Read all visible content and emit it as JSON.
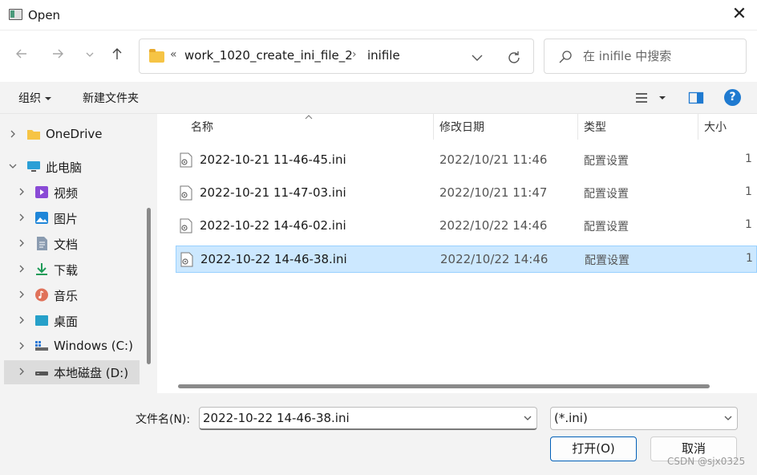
{
  "window": {
    "title": "Open",
    "close_glyph": "✕"
  },
  "nav": {
    "back_icon": "arrow-left-icon",
    "forward_icon": "arrow-right-icon",
    "recent_icon": "chevron-down-icon",
    "up_icon": "arrow-up-icon",
    "breadcrumb_overflow": "«",
    "breadcrumb": [
      "work_1020_create_ini_file_2",
      "inifile"
    ],
    "breadcrumb_sep": "›",
    "search_placeholder": "在 inifile 中搜索"
  },
  "toolbar": {
    "organize_label": "组织",
    "new_folder_label": "新建文件夹",
    "help_label": "?"
  },
  "sidebar": {
    "items": [
      {
        "label": "OneDrive",
        "icon": "folder-icon",
        "expanded": false
      },
      {
        "label": "此电脑",
        "icon": "computer-icon",
        "expanded": true
      },
      {
        "label": "视频",
        "icon": "videos-icon",
        "expanded": false
      },
      {
        "label": "图片",
        "icon": "pictures-icon",
        "expanded": false
      },
      {
        "label": "文档",
        "icon": "documents-icon",
        "expanded": false
      },
      {
        "label": "下载",
        "icon": "downloads-icon",
        "expanded": false
      },
      {
        "label": "音乐",
        "icon": "music-icon",
        "expanded": false
      },
      {
        "label": "桌面",
        "icon": "desktop-icon",
        "expanded": false
      },
      {
        "label": "Windows (C:)",
        "icon": "drive-icon",
        "expanded": false
      },
      {
        "label": "本地磁盘 (D:)",
        "icon": "drive-icon",
        "expanded": false,
        "selected": true
      }
    ]
  },
  "columns": {
    "name": "名称",
    "date": "修改日期",
    "type": "类型",
    "size": "大小"
  },
  "files": [
    {
      "name": "2022-10-21 11-46-45.ini",
      "date": "2022/10/21 11:46",
      "type": "配置设置",
      "size": "1"
    },
    {
      "name": "2022-10-21 11-47-03.ini",
      "date": "2022/10/21 11:47",
      "type": "配置设置",
      "size": "1"
    },
    {
      "name": "2022-10-22 14-46-02.ini",
      "date": "2022/10/22 14:46",
      "type": "配置设置",
      "size": "1"
    },
    {
      "name": "2022-10-22 14-46-38.ini",
      "date": "2022/10/22 14:46",
      "type": "配置设置",
      "size": "1",
      "selected": true
    }
  ],
  "bottom": {
    "filename_label": "文件名(N):",
    "filename_value": "2022-10-22 14-46-38.ini",
    "filter_value": "(*.ini)",
    "open_label": "打开(O)",
    "cancel_label": "取消",
    "watermark": "CSDN @sjx0325"
  },
  "colors": {
    "accent": "#1f7ad0",
    "selection": "#cce8ff",
    "selection_border": "#99d1ff"
  }
}
